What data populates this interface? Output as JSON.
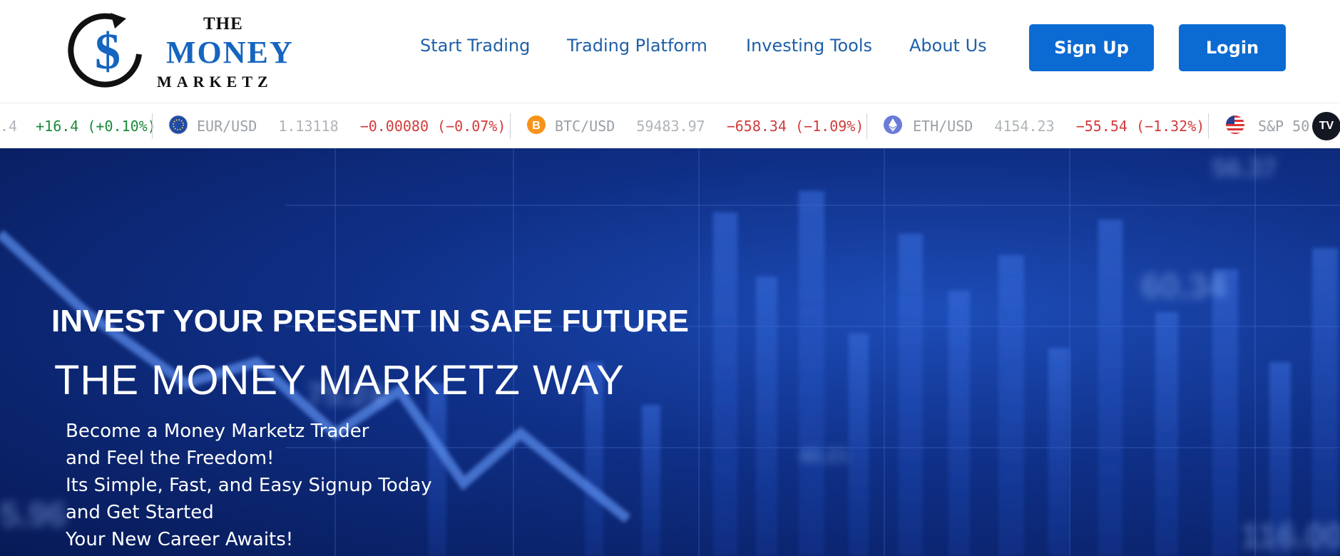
{
  "logo": {
    "line1": "THE",
    "line2": "MONEY",
    "line3": "MARKETZ",
    "symbol": "$"
  },
  "nav": {
    "items": [
      {
        "label": "Start Trading"
      },
      {
        "label": "Trading Platform"
      },
      {
        "label": "Investing Tools"
      },
      {
        "label": "About Us"
      }
    ],
    "signup_label": "Sign Up",
    "login_label": "Login"
  },
  "ticker": {
    "items": [
      {
        "symbol": "",
        "price": ".4",
        "change": "+16.4 (+0.10%)",
        "direction": "up"
      },
      {
        "symbol": "EUR/USD",
        "price": "1.13118",
        "change": "−0.00080 (−0.07%)",
        "direction": "down",
        "icon": "eu-flag-icon"
      },
      {
        "symbol": "BTC/USD",
        "price": "59483.97",
        "change": "−658.34 (−1.09%)",
        "direction": "down",
        "icon": "bitcoin-icon"
      },
      {
        "symbol": "ETH/USD",
        "price": "4154.23",
        "change": "−55.54 (−1.32%)",
        "direction": "down",
        "icon": "ethereum-icon"
      },
      {
        "symbol": "S&P 50",
        "price": "",
        "change": "",
        "direction": "none",
        "icon": "us-flag-icon"
      }
    ],
    "widget_logo": "TV"
  },
  "hero": {
    "headline": "INVEST YOUR PRESENT IN SAFE FUTURE",
    "subheadline": "THE MONEY MARKETZ WAY",
    "lines": [
      "Become a Money Marketz Trader",
      "and Feel the Freedom!",
      "Its Simple, Fast, and Easy Signup Today",
      "and Get Started",
      "Your New Career Awaits!"
    ]
  },
  "colors": {
    "brand_blue": "#0b6bd3",
    "nav_text": "#1e5fa8",
    "up": "#1a8a3a",
    "down": "#d23b3b",
    "hero_bg": "#0f2f86"
  }
}
